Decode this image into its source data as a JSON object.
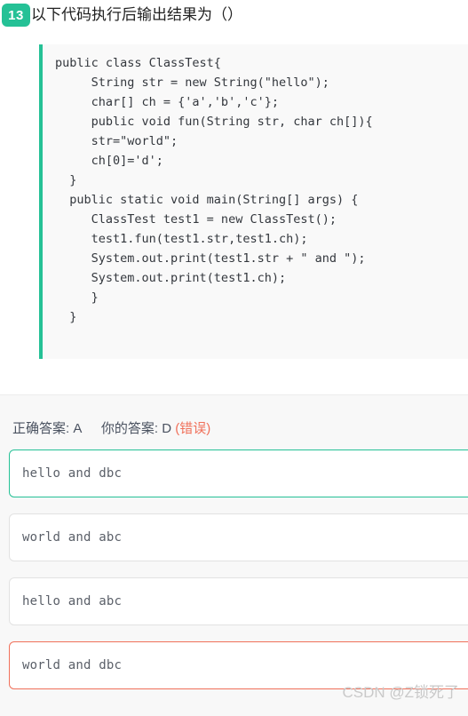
{
  "question": {
    "number": "13",
    "title": "以下代码执行后输出结果为（）",
    "code": "public class ClassTest{\n     String str = new String(\"hello\");\n     char[] ch = {'a','b','c'};\n     public void fun(String str, char ch[]){\n     str=\"world\";\n     ch[0]='d';\n  }\n  public static void main(String[] args) {\n     ClassTest test1 = new ClassTest();\n     test1.fun(test1.str,test1.ch);\n     System.out.print(test1.str + \" and \");\n     System.out.print(test1.ch);\n     }\n  }"
  },
  "answer": {
    "correct_label": "正确答案:",
    "correct_value": "A",
    "your_label": "你的答案:",
    "your_value": "D",
    "verdict": "(错误)",
    "options": [
      {
        "key": "A",
        "text": "hello and dbc",
        "state": "correct"
      },
      {
        "key": "B",
        "text": "world and abc",
        "state": "normal"
      },
      {
        "key": "C",
        "text": "hello and abc",
        "state": "normal"
      },
      {
        "key": "D",
        "text": "world and dbc",
        "state": "chosen-wrong"
      }
    ]
  },
  "watermark": {
    "text": "CSDN @Z锁死了"
  },
  "colors": {
    "accent_green": "#25c196",
    "wrong_red": "#f0705a",
    "code_bg": "#f9f9f9",
    "panel_bg": "#f8f8f8"
  }
}
